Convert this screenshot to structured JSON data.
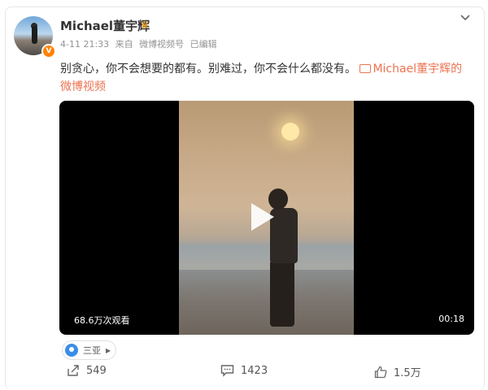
{
  "post": {
    "author": "Michael董宇辉",
    "verified_mark": "V",
    "time": "4-11 21:33",
    "source_prefix": "来自",
    "source": "微博视频号",
    "edited": "已编辑",
    "text_main": "别贪心，你不会想要的都有。别难过，你不会什么都没有。",
    "video_link_line1": "Michael董宇辉的",
    "video_link_line2": "微博视频"
  },
  "video": {
    "views": "68.6万次观看",
    "duration": "00:18"
  },
  "location": {
    "label": "三亚"
  },
  "actions": {
    "share_count": "549",
    "comment_count": "1423",
    "like_count": "1.5万"
  },
  "colors": {
    "link": "#eb7350",
    "badge": "#ff8200",
    "pin": "#3a8ee6"
  },
  "icons": [
    "avatar",
    "verified-badge-icon",
    "crown-icon",
    "chevron-down-icon",
    "video-link-icon",
    "play-icon",
    "location-pin-icon",
    "share-icon",
    "comment-icon",
    "like-icon"
  ]
}
